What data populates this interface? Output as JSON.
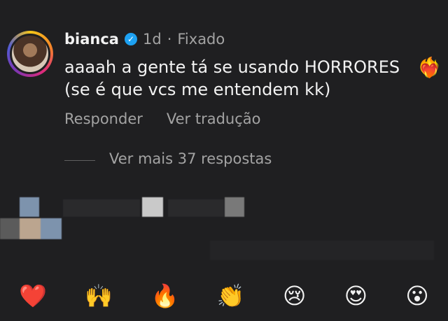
{
  "comment": {
    "username": "bianca",
    "time": "1d",
    "pinned_label": "Fixado",
    "text_line1": "aaaah a gente tá se usando HORRORES",
    "text_line2": "(se é que vcs me entendem kk)"
  },
  "actions": {
    "reply": "Responder",
    "translate": "Ver tradução"
  },
  "replies": {
    "label": "Ver mais 37 respostas"
  },
  "reactions": [
    "❤️",
    "🙌",
    "🔥",
    "👏",
    "😢",
    "😍",
    "😮"
  ]
}
